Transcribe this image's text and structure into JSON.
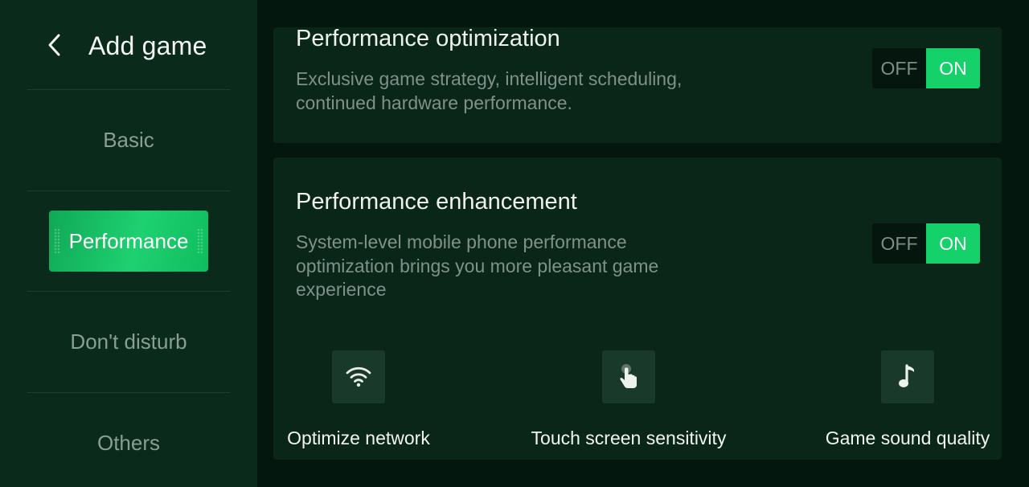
{
  "header": {
    "title": "Add game"
  },
  "sidebar": {
    "items": [
      {
        "label": "Basic"
      },
      {
        "label": "Performance"
      },
      {
        "label": "Don't disturb"
      },
      {
        "label": "Others"
      }
    ],
    "active_index": 1
  },
  "cards": {
    "optimization": {
      "title": "Performance optimization",
      "description": "Exclusive game strategy, intelligent scheduling, continued hardware performance.",
      "toggle": {
        "off_label": "OFF",
        "on_label": "ON",
        "state": "on"
      }
    },
    "enhancement": {
      "title": "Performance enhancement",
      "description": "System-level mobile phone performance optimization brings you more pleasant game experience",
      "toggle": {
        "off_label": "OFF",
        "on_label": "ON",
        "state": "on"
      },
      "features": [
        {
          "label": "Optimize network",
          "icon": "wifi-icon"
        },
        {
          "label": "Touch screen sensitivity",
          "icon": "touch-icon"
        },
        {
          "label": "Game sound quality",
          "icon": "music-note-icon"
        }
      ]
    }
  },
  "colors": {
    "accent": "#15d169",
    "sidebar_bg": "#0a2b1c",
    "card_bg": "#0a2619",
    "page_bg": "#04170f"
  }
}
